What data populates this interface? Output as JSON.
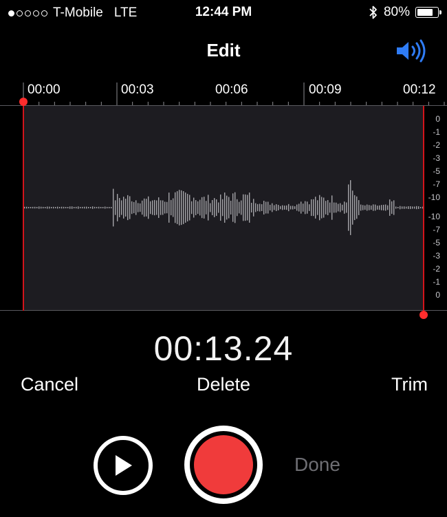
{
  "status": {
    "carrier": "T-Mobile",
    "network": "LTE",
    "time": "12:44 PM",
    "battery_text": "80%",
    "battery_level": 0.8,
    "signal_bars_filled": 1,
    "signal_bars_total": 5
  },
  "nav": {
    "title": "Edit",
    "speaker_icon": "speaker-volume-icon"
  },
  "timeline": {
    "labels": [
      "00:00",
      "00:03",
      "00:06",
      "00:09",
      "00:12"
    ]
  },
  "waveform": {
    "db_scale": [
      "0",
      "-1",
      "-2",
      "-3",
      "-5",
      "-7",
      "-10",
      "-10",
      "-7",
      "-5",
      "-3",
      "-2",
      "-1",
      "0"
    ]
  },
  "elapsed": "00:13.24",
  "actions": {
    "cancel": "Cancel",
    "delete": "Delete",
    "trim": "Trim"
  },
  "controls": {
    "done": "Done",
    "play_icon": "play-icon",
    "record_icon": "record-icon"
  },
  "colors": {
    "accent_blue": "#2f7cf6",
    "record_red": "#f03b3b",
    "trim_red": "#d4141b",
    "wave_background": "#1d1c21"
  }
}
